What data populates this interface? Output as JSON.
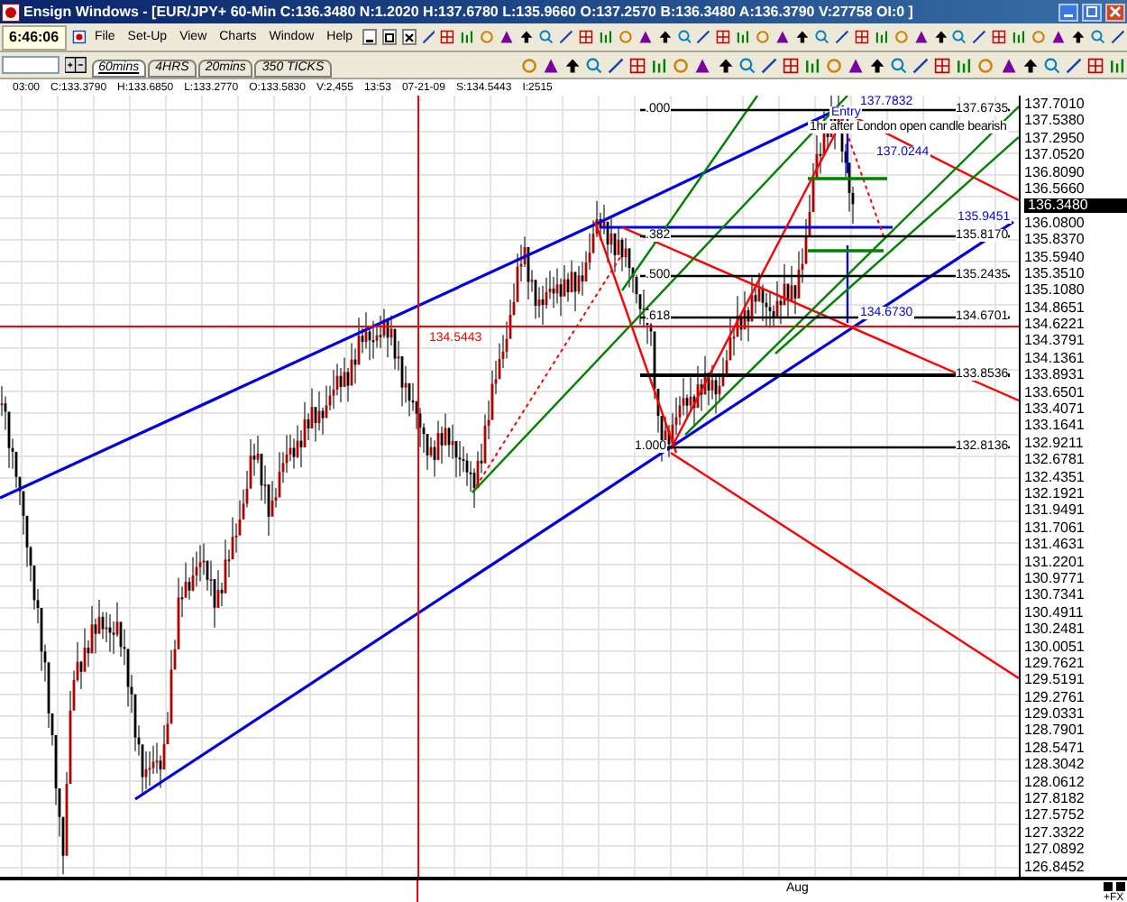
{
  "window": {
    "title": "Ensign Windows - [EUR/JPY+ 60-Min C:136.3480 N:1.2020 H:137.6780 L:135.9660 O:137.2570 B:136.3480 A:136.3790 V:27758 OI:0 ]"
  },
  "clock": "6:46:06",
  "menu": [
    "File",
    "Set-Up",
    "View",
    "Charts",
    "Window",
    "Help"
  ],
  "tabs": [
    {
      "label": "60mins",
      "selected": true
    },
    {
      "label": "4HRS",
      "selected": false
    },
    {
      "label": "20mins",
      "selected": false
    },
    {
      "label": "350 TICKS",
      "selected": false
    }
  ],
  "info_line": [
    "03:00",
    "C:133.3790",
    "H:133.6850",
    "L:133.2770",
    "O:133.5830",
    "V:2,455",
    "13:53",
    "07-21-09",
    "S:134.5443",
    "I:2515"
  ],
  "chart": {
    "levels": [
      {
        "ratio": ".000",
        "price": "137.6735"
      },
      {
        "ratio": ".382",
        "price": "135.8170"
      },
      {
        "ratio": ".500",
        "price": "135.2435"
      },
      {
        "ratio": ".618",
        "price": "134.6701"
      },
      {
        "price": "133.8536"
      },
      {
        "ratio": "1.000",
        "price": "132.8136"
      }
    ],
    "notes": [
      {
        "kind": "blue",
        "text": "137.7832"
      },
      {
        "kind": "blue",
        "text": "Entry"
      },
      {
        "kind": "black",
        "text": "1hr after London open candle bearish"
      },
      {
        "kind": "blue",
        "text": "137.0244"
      },
      {
        "kind": "blue",
        "text": "135.9451"
      },
      {
        "kind": "blue",
        "text": "134.6730"
      },
      {
        "kind": "red",
        "text": "134.5443"
      }
    ],
    "price_labels": [
      {
        "text": "137.7010",
        "current": false
      },
      {
        "text": "137.5380",
        "current": false
      },
      {
        "text": "137.2950",
        "current": false
      },
      {
        "text": "137.0520",
        "current": false
      },
      {
        "text": "136.8090",
        "current": false
      },
      {
        "text": "136.5660",
        "current": false
      },
      {
        "text": "136.3480",
        "current": true
      },
      {
        "text": "136.0800",
        "current": false
      },
      {
        "text": "135.8370",
        "current": false
      },
      {
        "text": "135.5940",
        "current": false
      },
      {
        "text": "135.3510",
        "current": false
      },
      {
        "text": "135.1080",
        "current": false
      },
      {
        "text": "134.8651",
        "current": false
      },
      {
        "text": "134.6221",
        "current": false
      },
      {
        "text": "134.3791",
        "current": false
      },
      {
        "text": "134.1361",
        "current": false
      },
      {
        "text": "133.8931",
        "current": false
      },
      {
        "text": "133.6501",
        "current": false
      },
      {
        "text": "133.4071",
        "current": false
      },
      {
        "text": "133.1641",
        "current": false
      },
      {
        "text": "132.9211",
        "current": false
      },
      {
        "text": "132.6781",
        "current": false
      },
      {
        "text": "132.4351",
        "current": false
      },
      {
        "text": "132.1921",
        "current": false
      },
      {
        "text": "131.9491",
        "current": false
      },
      {
        "text": "131.7061",
        "current": false
      },
      {
        "text": "131.4631",
        "current": false
      },
      {
        "text": "131.2201",
        "current": false
      },
      {
        "text": "130.9771",
        "current": false
      },
      {
        "text": "130.7341",
        "current": false
      },
      {
        "text": "130.4911",
        "current": false
      },
      {
        "text": "130.2481",
        "current": false
      },
      {
        "text": "130.0051",
        "current": false
      },
      {
        "text": "129.7621",
        "current": false
      },
      {
        "text": "129.5191",
        "current": false
      },
      {
        "text": "129.2761",
        "current": false
      },
      {
        "text": "129.0331",
        "current": false
      },
      {
        "text": "128.7901",
        "current": false
      },
      {
        "text": "128.5471",
        "current": false
      },
      {
        "text": "128.3042",
        "current": false
      },
      {
        "text": "128.0612",
        "current": false
      },
      {
        "text": "127.8182",
        "current": false
      },
      {
        "text": "127.5752",
        "current": false
      },
      {
        "text": "127.3322",
        "current": false
      },
      {
        "text": "127.0892",
        "current": false
      },
      {
        "text": "126.8452",
        "current": false
      }
    ],
    "time_labels": [
      "Aug"
    ]
  },
  "corner_label": "+FX"
}
